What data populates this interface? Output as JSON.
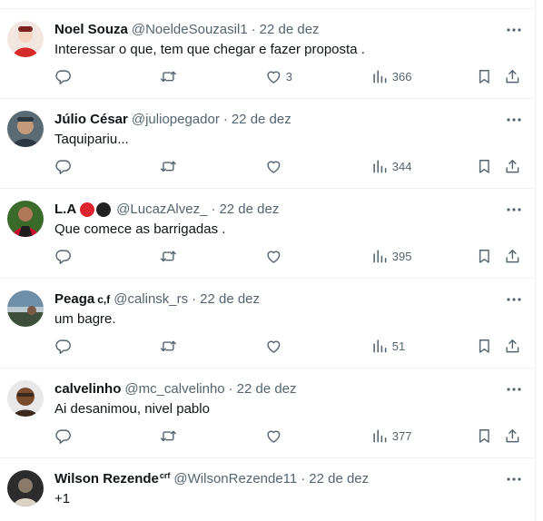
{
  "tweets": [
    {
      "name": "Noel Souza",
      "handle": "@NoeldeSouzasil1",
      "separator": "·",
      "date": "22 de dez",
      "text": "Interessar o que, tem que chegar e fazer proposta .",
      "replies": "",
      "retweets": "",
      "likes": "3",
      "views": "366",
      "avatar_colors": [
        "#7b1f1f",
        "#d42a2a",
        "#f4d3c0"
      ]
    },
    {
      "name": "Júlio César",
      "handle": "@juliopegador",
      "separator": "·",
      "date": "22 de dez",
      "text": "Taquipariu...",
      "replies": "",
      "retweets": "",
      "likes": "",
      "views": "344",
      "avatar_colors": [
        "#5a6b74",
        "#c49a7a",
        "#2b3a42"
      ]
    },
    {
      "name": "L.A",
      "handle": "@LucazAlvez_",
      "separator": "·",
      "date": "22 de dez",
      "text": "Que comece as barrigadas .",
      "replies": "",
      "retweets": "",
      "likes": "",
      "views": "395",
      "badge_colors": [
        "#e0242f",
        "#222222"
      ],
      "avatar_colors": [
        "#1e1e1e",
        "#c8102e",
        "#3a6b2a"
      ]
    },
    {
      "name": "Peaga",
      "name_suffix": "c,f",
      "handle": "@calinsk_rs",
      "separator": "·",
      "date": "22 de dez",
      "text": "um bagre.",
      "replies": "",
      "retweets": "",
      "likes": "",
      "views": "51",
      "avatar_colors": [
        "#6f8ea8",
        "#3e4f3a",
        "#b9c7cf"
      ]
    },
    {
      "name": "calvelinho",
      "handle": "@mc_calvelinho",
      "separator": "·",
      "date": "22 de dez",
      "text": "Ai desanimou, nivel pablo",
      "replies": "",
      "retweets": "",
      "likes": "",
      "views": "377",
      "avatar_colors": [
        "#e8e8e8",
        "#3b2a1f",
        "#7a4c2e"
      ]
    },
    {
      "name": "Wilson Rezende",
      "name_suffix": "crf",
      "handle": "@WilsonRezende11",
      "separator": "·",
      "date": "22 de dez",
      "text": "+1",
      "avatar_colors": [
        "#2c2c2c",
        "#8a7b6a",
        "#d9d2c5"
      ]
    }
  ],
  "colors": {
    "text": "#0f1419",
    "secondary": "#536471",
    "divider": "#eff3f4"
  },
  "icons": {
    "reply": "reply-icon",
    "retweet": "retweet-icon",
    "like": "like-icon",
    "views": "views-icon",
    "bookmark": "bookmark-icon",
    "share": "share-icon",
    "more": "more-icon"
  }
}
